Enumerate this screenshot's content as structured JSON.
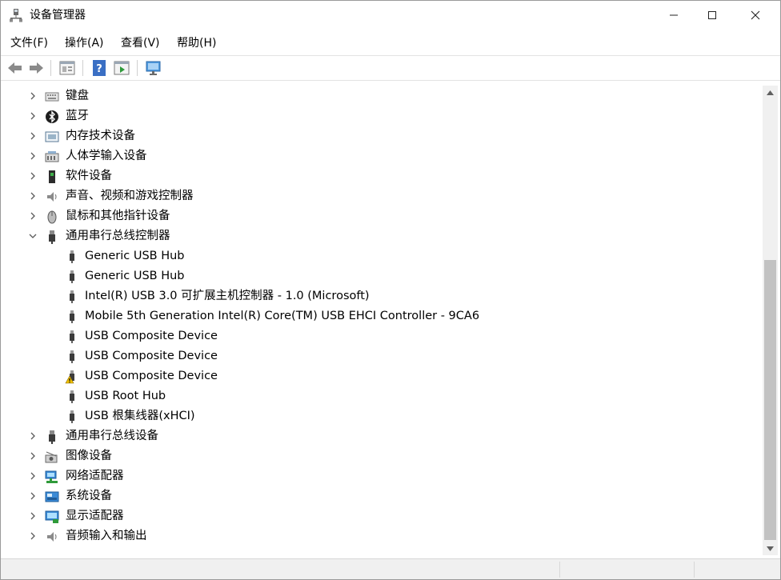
{
  "window": {
    "title": "设备管理器",
    "minimize_glyph": "—",
    "maximize_glyph": "☐",
    "close_glyph": "✕"
  },
  "menu": {
    "file": "文件(F)",
    "action": "操作(A)",
    "view": "查看(V)",
    "help": "帮助(H)"
  },
  "toolbar": {
    "icons": [
      "back-icon",
      "forward-icon",
      "properties-icon",
      "help-icon",
      "update-driver-icon",
      "scan-hardware-icon"
    ]
  },
  "tree": {
    "categories_before": [
      {
        "label": "键盘",
        "icon": "keyboard-icon",
        "expanded": false
      },
      {
        "label": "蓝牙",
        "icon": "bluetooth-icon",
        "expanded": false
      },
      {
        "label": "内存技术设备",
        "icon": "memory-icon",
        "expanded": false
      },
      {
        "label": "人体学输入设备",
        "icon": "hid-icon",
        "expanded": false
      },
      {
        "label": "软件设备",
        "icon": "software-device-icon",
        "expanded": false
      },
      {
        "label": "声音、视频和游戏控制器",
        "icon": "sound-icon",
        "expanded": false
      },
      {
        "label": "鼠标和其他指针设备",
        "icon": "mouse-icon",
        "expanded": false
      }
    ],
    "usb_controllers": {
      "label": "通用串行总线控制器",
      "icon": "usb-icon",
      "expanded": true,
      "children": [
        {
          "label": "Generic USB Hub",
          "warning": false
        },
        {
          "label": "Generic USB Hub",
          "warning": false
        },
        {
          "label": "Intel(R) USB 3.0 可扩展主机控制器 - 1.0 (Microsoft)",
          "warning": false
        },
        {
          "label": "Mobile 5th Generation Intel(R) Core(TM) USB EHCI Controller - 9CA6",
          "warning": false
        },
        {
          "label": "USB Composite Device",
          "warning": false
        },
        {
          "label": "USB Composite Device",
          "warning": false
        },
        {
          "label": "USB Composite Device",
          "warning": true
        },
        {
          "label": "USB Root Hub",
          "warning": false
        },
        {
          "label": "USB 根集线器(xHCI)",
          "warning": false
        }
      ]
    },
    "categories_after": [
      {
        "label": "通用串行总线设备",
        "icon": "usb-device-icon",
        "expanded": false
      },
      {
        "label": "图像设备",
        "icon": "imaging-icon",
        "expanded": false
      },
      {
        "label": "网络适配器",
        "icon": "network-adapter-icon",
        "expanded": false
      },
      {
        "label": "系统设备",
        "icon": "system-device-icon",
        "expanded": false
      },
      {
        "label": "显示适配器",
        "icon": "display-adapter-icon",
        "expanded": false
      },
      {
        "label": "音频输入和输出",
        "icon": "audio-io-icon",
        "expanded": false
      }
    ]
  },
  "colors": {
    "warning": "#f2c200",
    "usb_plug": "#3c3c3c",
    "scroll_thumb": "#c2c2c2"
  }
}
